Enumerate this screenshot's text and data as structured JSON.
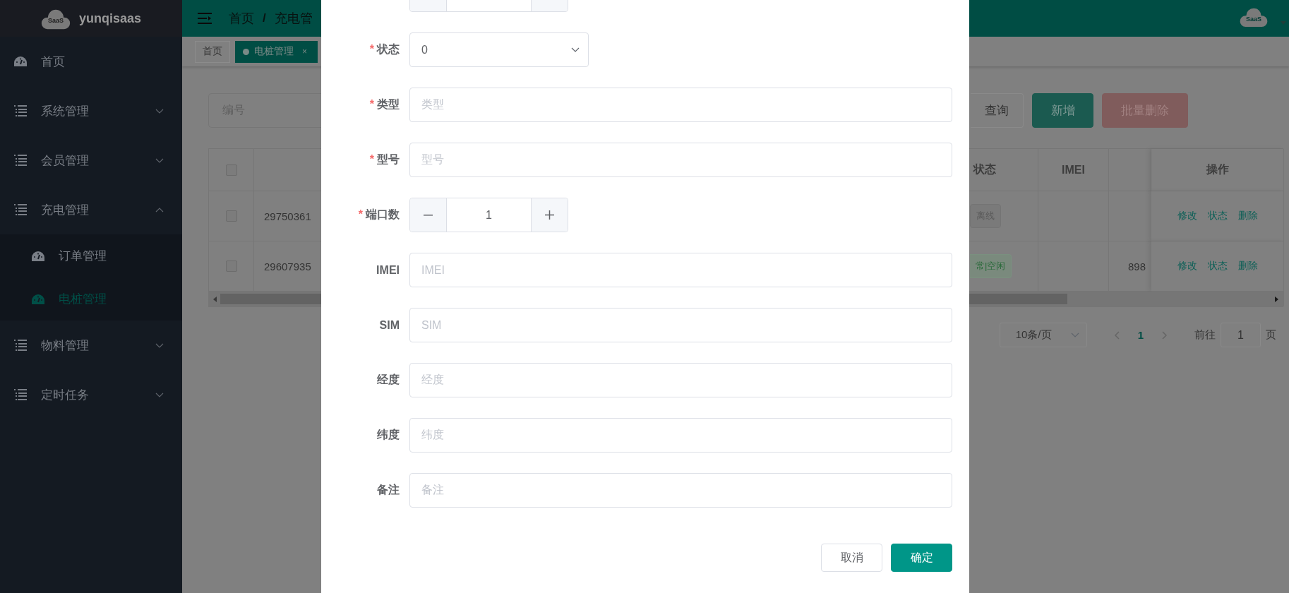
{
  "sidebar": {
    "logo_text": "SaaS",
    "title": "yunqisaas",
    "items": [
      {
        "label": "首页",
        "kind": "link",
        "selected": false
      },
      {
        "label": "系统管理",
        "kind": "group",
        "expanded": false
      },
      {
        "label": "会员管理",
        "kind": "group",
        "expanded": false
      },
      {
        "label": "充电管理",
        "kind": "group",
        "expanded": true,
        "children": [
          {
            "label": "订单管理",
            "selected": false
          },
          {
            "label": "电桩管理",
            "selected": true
          }
        ]
      },
      {
        "label": "物料管理",
        "kind": "group",
        "expanded": false
      },
      {
        "label": "定时任务",
        "kind": "group",
        "expanded": false
      }
    ]
  },
  "topbar": {
    "breadcrumb": [
      "首页",
      "充电管"
    ],
    "separator": "/",
    "avatar_text": "SaaS"
  },
  "tags": [
    {
      "label": "首页",
      "selected": false
    },
    {
      "label": "电桩管理",
      "selected": true,
      "close": "×"
    }
  ],
  "filters": {
    "search": {
      "placeholder": "编号"
    },
    "buttons": [
      {
        "label": "查询",
        "kind": "default"
      },
      {
        "label": "新增",
        "kind": "primary"
      },
      {
        "label": "批量删除",
        "kind": "danger",
        "disabled": true
      }
    ]
  },
  "table": {
    "select_all": {
      "checked": false
    },
    "columns": [
      {
        "label": "状态"
      },
      {
        "label": "IMEI"
      },
      {
        "label": "操作"
      }
    ],
    "rows": [
      {
        "checked": false,
        "number": "29750361",
        "status": "离线",
        "color": "#5a5a5a",
        "actions": [
          "修改",
          "状态",
          "删除"
        ]
      },
      {
        "checked": false,
        "number": "29607935",
        "status": "常|空闲",
        "color": "#2a6a3a",
        "column_6": "898",
        "actions": [
          "修改",
          "状态",
          "删除"
        ]
      }
    ]
  },
  "pagination": {
    "page_size": "10条/页",
    "pages": [
      {
        "label": "1",
        "selected": true
      }
    ],
    "goto_label": "前往",
    "goto_value": "1",
    "page_suffix": "页"
  },
  "dialog": {
    "required_mark": "*",
    "fields": [
      {
        "label": "状态",
        "required": true,
        "kind": "select",
        "value": "0"
      },
      {
        "label": "类型",
        "required": true,
        "kind": "text",
        "placeholder": "类型"
      },
      {
        "label": "型号",
        "required": true,
        "kind": "text",
        "placeholder": "型号"
      },
      {
        "label": "端口数",
        "required": true,
        "kind": "number",
        "value": "1"
      },
      {
        "label": "IMEI",
        "required": false,
        "kind": "text",
        "placeholder": "IMEI"
      },
      {
        "label": "SIM",
        "required": false,
        "kind": "text",
        "placeholder": "SIM"
      },
      {
        "label": "经度",
        "required": false,
        "kind": "text",
        "placeholder": "经度"
      },
      {
        "label": "纬度",
        "required": false,
        "kind": "text",
        "placeholder": "纬度"
      },
      {
        "label": "备注",
        "required": false,
        "kind": "text",
        "placeholder": "备注"
      }
    ],
    "buttons": [
      {
        "label": "取消",
        "kind": "default"
      },
      {
        "label": "确定",
        "kind": "primary"
      }
    ]
  }
}
